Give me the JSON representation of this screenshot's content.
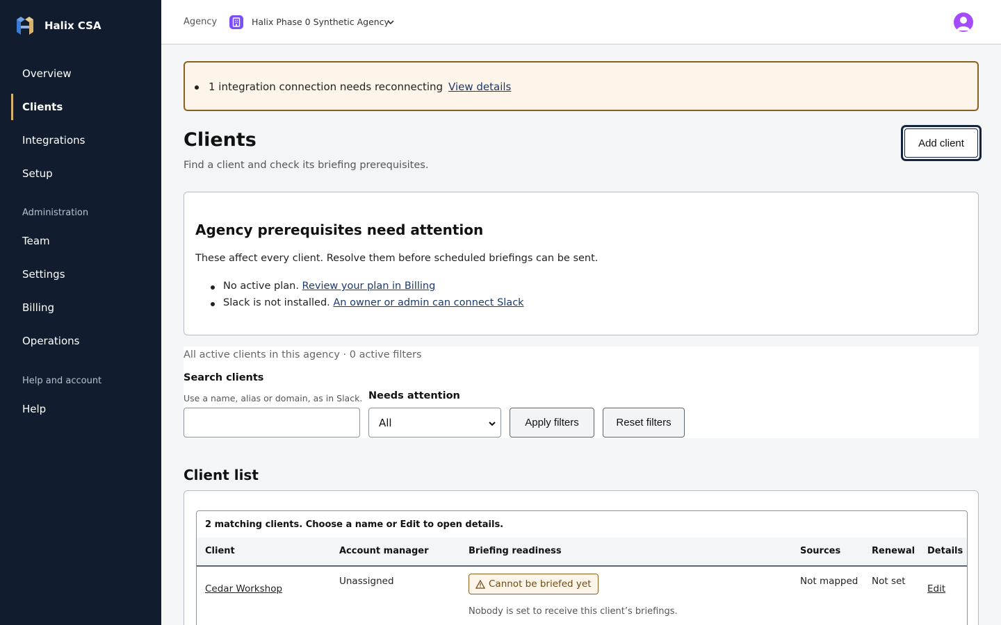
{
  "brand": {
    "name": "Halix CSA"
  },
  "sidebar": {
    "items": [
      {
        "label": "Overview"
      },
      {
        "label": "Clients"
      },
      {
        "label": "Integrations"
      },
      {
        "label": "Setup"
      }
    ],
    "admin_section": "Administration",
    "admin_items": [
      {
        "label": "Team"
      },
      {
        "label": "Settings"
      },
      {
        "label": "Billing"
      },
      {
        "label": "Operations"
      }
    ],
    "help_section": "Help and account",
    "help_items": [
      {
        "label": "Help"
      }
    ],
    "active": "Clients"
  },
  "topbar": {
    "agency_label": "Agency",
    "agency_name": "Halix Phase 0 Synthetic Agency"
  },
  "alert": {
    "text": "1 integration connection needs reconnecting",
    "link": "View details"
  },
  "header": {
    "title": "Clients",
    "subtitle": "Find a client and check its briefing prerequisites.",
    "add_button": "Add client"
  },
  "prereq": {
    "title": "Agency prerequisites need attention",
    "description": "These affect every client. Resolve them before scheduled briefings can be sent.",
    "items": [
      {
        "text": "No active plan. ",
        "link": "Review your plan in Billing"
      },
      {
        "text": "Slack is not installed. ",
        "link": "An owner or admin can connect Slack"
      }
    ]
  },
  "filters": {
    "summary": "All active clients in this agency · 0 active filters",
    "search_label": "Search clients",
    "search_hint": "Use a name, alias or domain, as in Slack.",
    "search_value": "",
    "needs_label": "Needs attention",
    "needs_value": "All",
    "apply": "Apply filters",
    "reset": "Reset filters"
  },
  "client_list": {
    "title": "Client list",
    "caption": "2 matching clients. Choose a name or Edit to open details.",
    "columns": [
      "Client",
      "Account manager",
      "Briefing readiness",
      "Sources",
      "Renewal",
      "Details"
    ],
    "rows": [
      {
        "client": "Cedar Workshop",
        "manager": "Unassigned",
        "status": "Cannot be briefed yet",
        "note": "Nobody is set to receive this client’s briefings.",
        "sources": "Not mapped",
        "renewal": "Not set",
        "details": "Edit"
      }
    ]
  },
  "colors": {
    "sidebar_bg": "#111d2e",
    "accent": "#d9b26a",
    "warning_border": "#8a6020",
    "warning_bg": "#fdf5ea",
    "link": "#1b3a6b",
    "agency_badge": "#7b4dff",
    "avatar": "#a44bff"
  }
}
